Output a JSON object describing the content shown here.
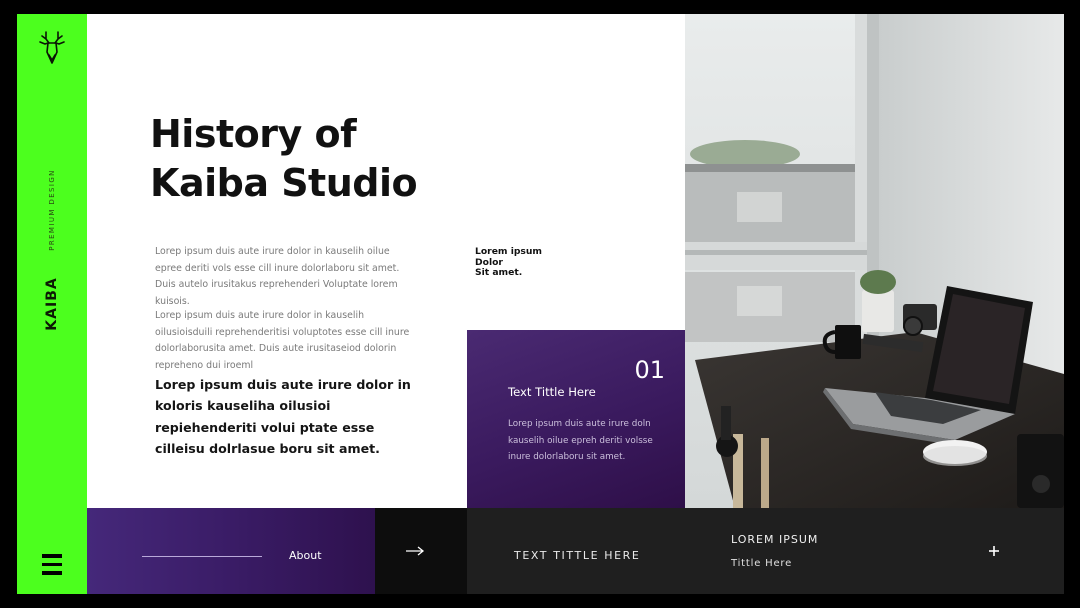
{
  "brand": {
    "name": "KAIBA",
    "tagline": "PREMIUM DESIGN",
    "accent_color": "#4cff1e",
    "logo_icon": "deer-head-icon"
  },
  "hero": {
    "title_line1": "History of",
    "title_line2": "Kaiba Studio"
  },
  "body": {
    "paragraph1": "Lorep  ipsum duis aute irure dolor in kauselih oilue epree deriti vols esse cill inure dolorlaboru sit amet. Duis autelo irusitakus reprehenderi Voluptate lorem kuisois.",
    "paragraph2": "Lorep  ipsum duis aute irure dolor in kauselih oilusioisduili reprehenderitisi voluptotes esse cill inure dolorlaborusita amet. Duis aute irusitaseiod dolorin repreheno dui iroeml",
    "paragraph_bold": "Lorep  ipsum duis aute irure dolor in koloris kauseliha oilusioi repiehenderiti volui ptate esse cilleisu dolrlasue boru sit amet.",
    "side_note_1": "Lorem ipsum",
    "side_note_2": "Dolor",
    "side_note_3": "Sit amet."
  },
  "card": {
    "number": "01",
    "title": "Text Tittle Here",
    "text": "Lorep  ipsum duis aute irure doln kauselih oilue epreh deriti volsse inure dolorlaboru sit amet."
  },
  "bottom_bar": {
    "about_label": "About",
    "arrow_icon": "arrow-right-icon",
    "section_title": "TEXT TITTLE HERE",
    "lorem_label": "LOREM IPSUM",
    "sub_label": "Tittle Here",
    "plus_icon": "plus-icon"
  },
  "colors": {
    "purple": "#3a1c66",
    "dark": "#1f1f1f",
    "black": "#0d0d0d"
  }
}
